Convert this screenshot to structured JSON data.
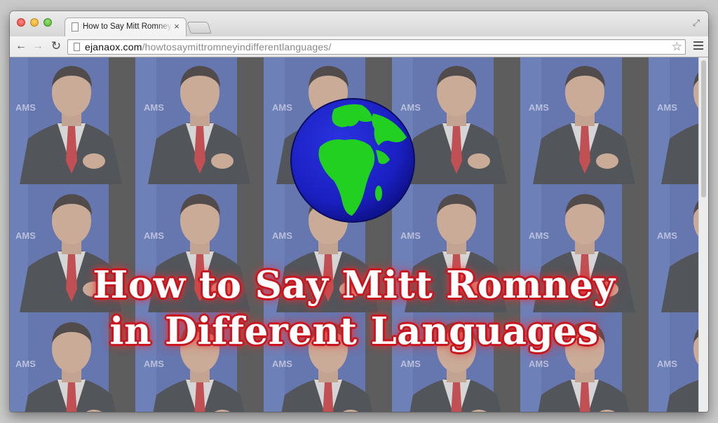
{
  "browser": {
    "tab": {
      "title": "How to Say Mitt Romney in Different Languages",
      "close_glyph": "×"
    },
    "toolbar": {
      "back_glyph": "←",
      "forward_glyph": "→",
      "reload_glyph": "↻",
      "url_domain": "ejanaox.com",
      "url_path": "/howtosaymittromneyindifferentlanguages/",
      "star_glyph": "☆"
    },
    "fullscreen_glyph": "⤢"
  },
  "page": {
    "headline_line1": "How to Say Mitt Romney",
    "headline_line2": "in Different Languages",
    "background_tile": "portrait-photo-tile",
    "globe": "rotating-earth-globe"
  },
  "colors": {
    "headline_fill": "#ffffff",
    "headline_outline": "#c8161f",
    "globe_ocean": "#1a1fc0",
    "globe_land": "#22d022",
    "tile_backdrop": "#4a62b8",
    "tile_overlay": "#9a9a9a"
  }
}
